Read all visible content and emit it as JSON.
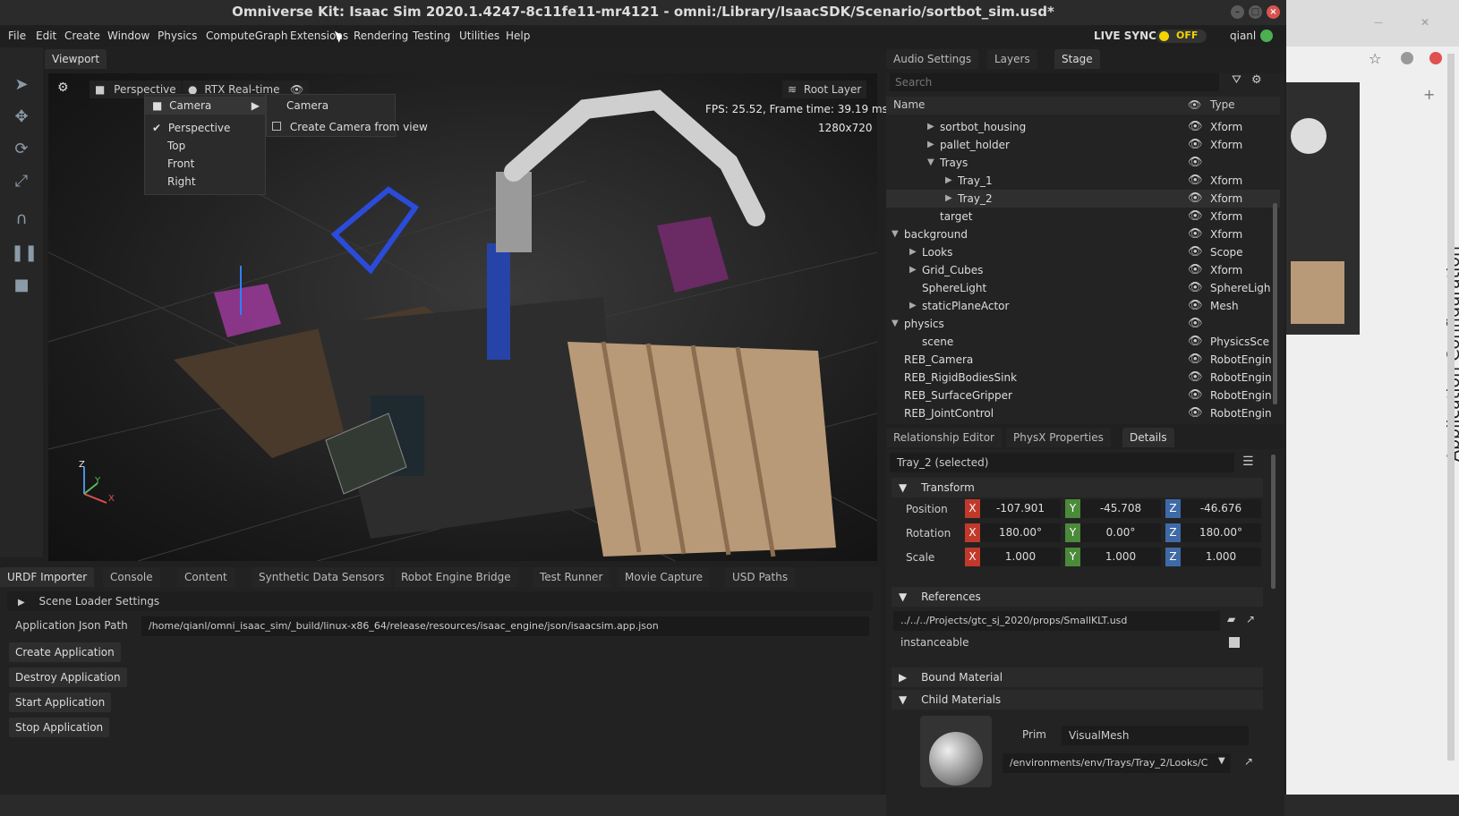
{
  "window": {
    "title": "Omniverse Kit: Isaac Sim 2020.1.4247-8c11fe11-mr4121 - omni:/Library/IsaacSDK/Scenario/sortbot_sim.usd*"
  },
  "menubar": {
    "items": [
      "File",
      "Edit",
      "Create",
      "Window",
      "Physics",
      "ComputeGraph",
      "Extensions",
      "Rendering",
      "Testing",
      "Utilities",
      "Help"
    ],
    "live_sync_label": "LIVE SYNC",
    "live_sync_state": "OFF",
    "user": "qianl"
  },
  "viewport": {
    "tab": "Viewport",
    "camera_label": "Perspective",
    "renderer_label": "RTX Real-time",
    "layer_label": "Root Layer",
    "fps_text": "FPS: 25.52, Frame time: 39.19 ms",
    "resolution": "1280x720",
    "axis_labels": {
      "z": "Z",
      "y": "Y",
      "x": "X"
    },
    "context_menu": {
      "camera_item": "Camera",
      "views": [
        "Perspective",
        "Top",
        "Front",
        "Right"
      ],
      "submenu": [
        "Camera",
        "Create Camera from view"
      ]
    }
  },
  "stage_panel": {
    "tabs": [
      "Audio Settings",
      "Layers",
      "Stage"
    ],
    "search_placeholder": "Search",
    "col_name": "Name",
    "col_type": "Type",
    "rows": [
      {
        "name": "sortbot_housing",
        "type": "Xform"
      },
      {
        "name": "pallet_holder",
        "type": "Xform"
      },
      {
        "name": "Trays",
        "type": ""
      },
      {
        "name": "Tray_1",
        "type": "Xform"
      },
      {
        "name": "Tray_2",
        "type": "Xform"
      },
      {
        "name": "target",
        "type": "Xform"
      },
      {
        "name": "background",
        "type": "Xform"
      },
      {
        "name": "Looks",
        "type": "Scope"
      },
      {
        "name": "Grid_Cubes",
        "type": "Xform"
      },
      {
        "name": "SphereLight",
        "type": "SphereLigh"
      },
      {
        "name": "staticPlaneActor",
        "type": "Mesh"
      },
      {
        "name": "physics",
        "type": ""
      },
      {
        "name": "scene",
        "type": "PhysicsSce"
      },
      {
        "name": "REB_Camera",
        "type": "RobotEngin"
      },
      {
        "name": "REB_RigidBodiesSink",
        "type": "RobotEngin"
      },
      {
        "name": "REB_SurfaceGripper",
        "type": "RobotEngin"
      },
      {
        "name": "REB_JointControl",
        "type": "RobotEngin"
      }
    ]
  },
  "props_panel": {
    "tabs": [
      "Relationship Editor",
      "PhysX Properties",
      "Details"
    ],
    "selected": "Tray_2 (selected)",
    "transform_label": "Transform",
    "position_label": "Position",
    "rotation_label": "Rotation",
    "scale_label": "Scale",
    "position": [
      "-107.901",
      "-45.708",
      "-46.676"
    ],
    "rotation": [
      "180.00°",
      "0.00°",
      "180.00°"
    ],
    "scale": [
      "1.000",
      "1.000",
      "1.000"
    ],
    "axis_tags": [
      "X",
      "Y",
      "Z"
    ],
    "references_label": "References",
    "reference_path": "../../../Projects/gtc_sj_2020/props/SmallKLT.usd",
    "instanceable_label": "instanceable",
    "bound_material_label": "Bound Material",
    "child_materials_label": "Child Materials",
    "prim_label": "Prim",
    "prim_value": "VisualMesh",
    "material_path": "/environments/env/Trays/Tray_2/Looks/C"
  },
  "bottom_panel": {
    "tabs": [
      "URDF Importer",
      "Console",
      "Content",
      "Synthetic Data Sensors",
      "Robot Engine Bridge",
      "Test Runner",
      "Movie Capture",
      "USD Paths"
    ],
    "scene_loader": "Scene Loader Settings",
    "json_path_label": "Application Json Path",
    "json_path_value": "/home/qianl/omni_isaac_sim/_build/linux-x86_64/release/resources/isaac_engine/json/isaacsim.app.json",
    "buttons": [
      "Create Application",
      "Destroy Application",
      "Start Application",
      "Stop Application"
    ]
  },
  "side_window": {
    "vertical_title": "Application Configuration"
  },
  "colors": {
    "x": "#c0392b",
    "y": "#4a8a3a",
    "z": "#3f6aa8",
    "live_sync_dot": "#f4d400"
  }
}
